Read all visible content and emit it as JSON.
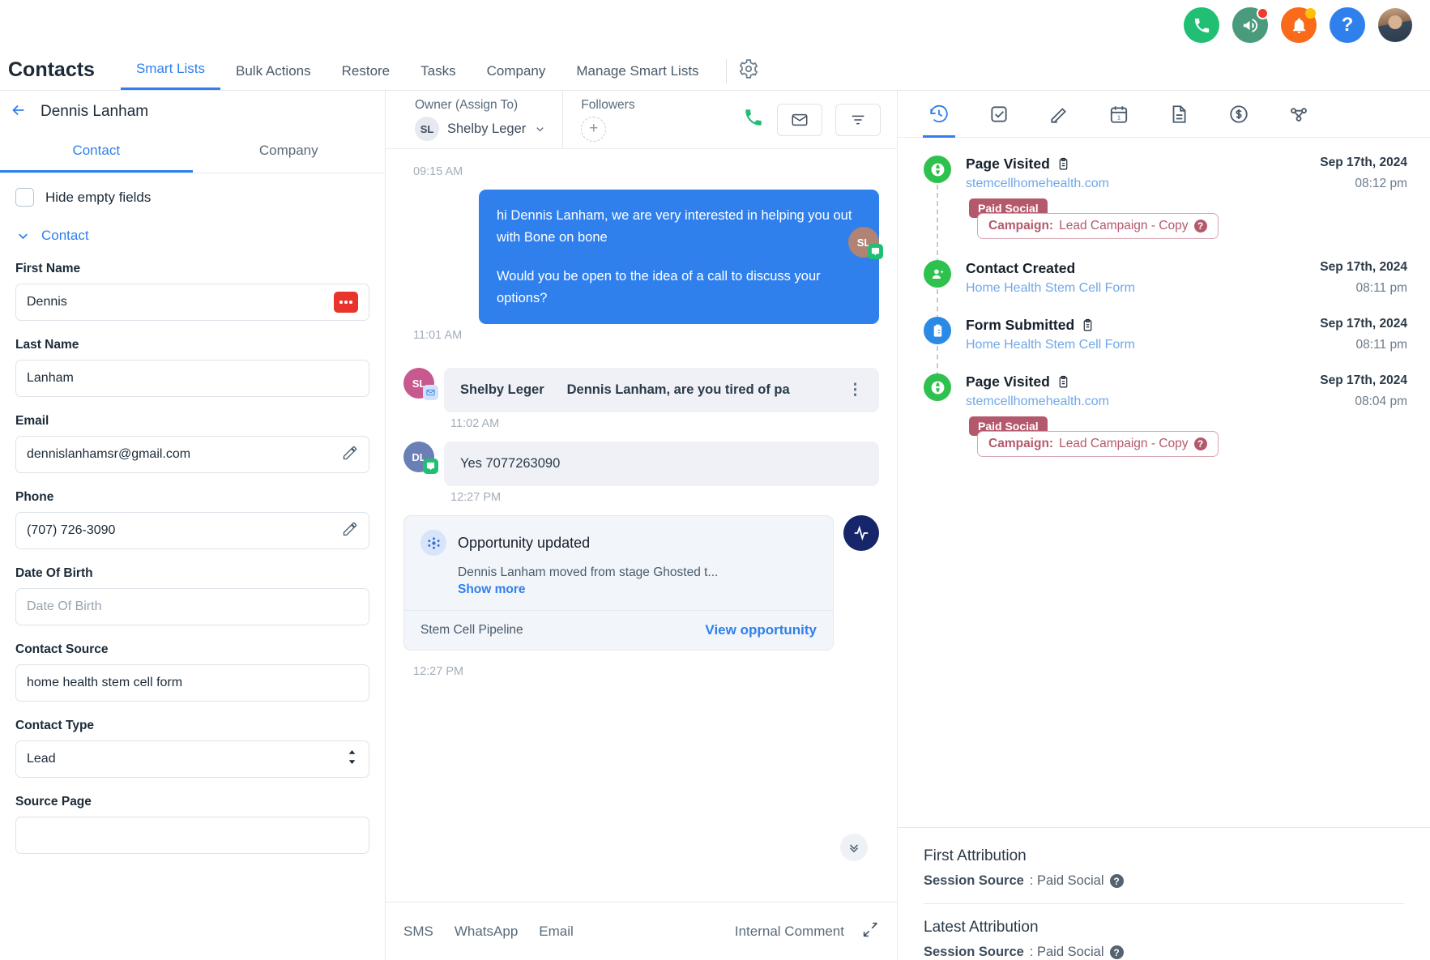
{
  "header": {
    "icons": [
      {
        "name": "phone-icon",
        "color": "#21bf73"
      },
      {
        "name": "megaphone-icon",
        "color": "#4a9a7c"
      },
      {
        "name": "bell-icon",
        "color": "#f96a1b"
      },
      {
        "name": "help-icon",
        "color": "#2f80ed",
        "glyph": "?"
      },
      {
        "name": "user-avatar"
      }
    ]
  },
  "nav": {
    "title": "Contacts",
    "items": [
      {
        "label": "Smart Lists",
        "active": true
      },
      {
        "label": "Bulk Actions",
        "active": false
      },
      {
        "label": "Restore",
        "active": false
      },
      {
        "label": "Tasks",
        "active": false
      },
      {
        "label": "Company",
        "active": false
      },
      {
        "label": "Manage Smart Lists",
        "active": false
      }
    ],
    "settings_icon": "gear-icon"
  },
  "left_panel": {
    "contact_name": "Dennis Lanham",
    "back_icon": "back-arrow-icon",
    "tabs": [
      {
        "label": "Contact",
        "active": true
      },
      {
        "label": "Company",
        "active": false
      }
    ],
    "hide_empty_label": "Hide empty fields",
    "section_label": "Contact",
    "fields": [
      {
        "label": "First Name",
        "value": "Dennis",
        "placeholder": "",
        "trailing": "red-dots-badge"
      },
      {
        "label": "Last Name",
        "value": "Lanham",
        "placeholder": "",
        "trailing": "none"
      },
      {
        "label": "Email",
        "value": "dennislanhamsr@gmail.com",
        "placeholder": "",
        "trailing": "pencil-icon"
      },
      {
        "label": "Phone",
        "value": "(707) 726-3090",
        "placeholder": "",
        "trailing": "pencil-icon"
      },
      {
        "label": "Date Of Birth",
        "value": "",
        "placeholder": "Date Of Birth",
        "trailing": "none"
      },
      {
        "label": "Contact Source",
        "value": "home health stem cell form",
        "placeholder": "",
        "trailing": "none"
      },
      {
        "label": "Contact Type",
        "value": "Lead",
        "placeholder": "",
        "trailing": "select-arrows"
      },
      {
        "label": "Source Page",
        "value": "",
        "placeholder": "",
        "trailing": "none"
      }
    ]
  },
  "conversation": {
    "owner_label": "Owner (Assign To)",
    "owner_initials": "SL",
    "owner_name": "Shelby Leger",
    "followers_label": "Followers",
    "followers_add": "+",
    "actions": [
      "call-icon",
      "email-icon",
      "filter-icon"
    ],
    "messages": [
      {
        "type": "timestamp",
        "time": "09:15 AM"
      },
      {
        "type": "outbound",
        "initials": "SL",
        "badge": "sms-badge",
        "paragraphs": [
          "hi Dennis Lanham, we are very interested in helping you out with Bone on bone",
          "Would you be open to the idea of a call to discuss your options?"
        ],
        "time": "11:01 AM"
      },
      {
        "type": "inbound-email",
        "initials": "SL",
        "badge": "email-badge",
        "sender": "Shelby Leger",
        "subject": "Dennis Lanham, are you tired of pa",
        "menu": "⋮",
        "time": "11:02 AM"
      },
      {
        "type": "inbound-sms",
        "initials": "DL",
        "badge": "sms-badge",
        "text": "Yes 7077263090",
        "time": "12:27 PM"
      }
    ],
    "opportunity": {
      "icon": "opportunity-icon",
      "title": "Opportunity updated",
      "description": "Dennis Lanham moved from stage Ghosted t...",
      "show_more": "Show more",
      "pipeline": "Stem Cell Pipeline",
      "view_link": "View opportunity",
      "side_icon": "activity-icon",
      "time": "12:27 PM"
    },
    "composer": {
      "tabs": [
        "SMS",
        "WhatsApp",
        "Email"
      ],
      "internal_comment": "Internal Comment",
      "expand_icon": "expand-icon"
    }
  },
  "right_panel": {
    "tabs": [
      {
        "name": "activity-tab",
        "icon": "clock-history-icon",
        "active": true
      },
      {
        "name": "tasks-tab",
        "icon": "checkbox-icon",
        "active": false
      },
      {
        "name": "notes-tab",
        "icon": "pencil-icon",
        "active": false
      },
      {
        "name": "appointments-tab",
        "icon": "calendar-icon",
        "active": false
      },
      {
        "name": "documents-tab",
        "icon": "document-icon",
        "active": false
      },
      {
        "name": "payments-tab",
        "icon": "dollar-icon",
        "active": false
      },
      {
        "name": "associations-tab",
        "icon": "share-nodes-icon",
        "active": false
      }
    ],
    "timeline": [
      {
        "icon": "globe-icon",
        "icon_color": "#2ec14e",
        "title": "Page Visited",
        "title_icon": "clipboard-icon",
        "date": "Sep 17th, 2024",
        "link": "stemcellhomehealth.com",
        "time": "08:12 pm",
        "tag": "Paid Social",
        "campaign_label": "Campaign:",
        "campaign_value": "Lead Campaign - Copy"
      },
      {
        "icon": "user-plus-icon",
        "icon_color": "#2ec14e",
        "title": "Contact Created",
        "title_icon": "",
        "date": "Sep 17th, 2024",
        "link": "Home Health Stem Cell Form",
        "time": "08:11 pm",
        "tag": "",
        "campaign_label": "",
        "campaign_value": ""
      },
      {
        "icon": "form-icon",
        "icon_color": "#2b8ae5",
        "title": "Form Submitted",
        "title_icon": "clipboard-icon",
        "date": "Sep 17th, 2024",
        "link": "Home Health Stem Cell Form",
        "time": "08:11 pm",
        "tag": "",
        "campaign_label": "",
        "campaign_value": ""
      },
      {
        "icon": "globe-icon",
        "icon_color": "#2ec14e",
        "title": "Page Visited",
        "title_icon": "clipboard-icon",
        "date": "Sep 17th, 2024",
        "link": "stemcellhomehealth.com",
        "time": "08:04 pm",
        "tag": "Paid Social",
        "campaign_label": "Campaign:",
        "campaign_value": "Lead Campaign - Copy"
      }
    ],
    "attribution": {
      "first_title": "First Attribution",
      "first_key": "Session Source",
      "first_value": ": Paid Social",
      "latest_title": "Latest Attribution",
      "latest_key": "Session Source",
      "latest_value": ": Paid Social"
    }
  }
}
